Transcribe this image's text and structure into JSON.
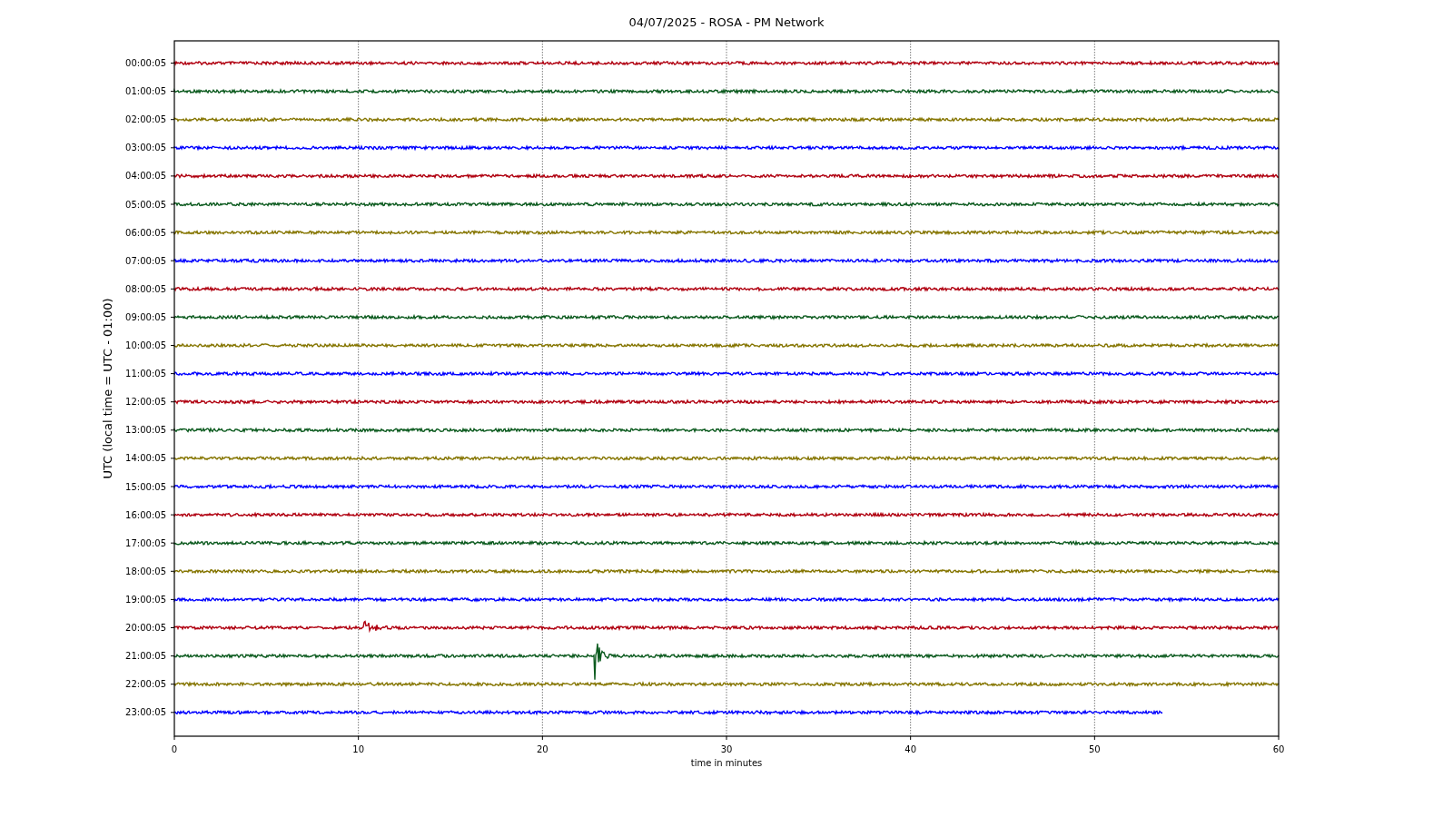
{
  "title": "04/07/2025 - ROSA - PM Network",
  "ylabel": "UTC (local time = UTC - 01:00)",
  "xlabel": "time in minutes",
  "xticks": [
    "0",
    "10",
    "20",
    "30",
    "40",
    "50",
    "60"
  ],
  "traces": [
    {
      "label": "00:00:05",
      "color": "#b00010",
      "level": 1
    },
    {
      "label": "01:00:05",
      "color": "#0b5a1e",
      "level": 1
    },
    {
      "label": "02:00:05",
      "color": "#857500",
      "level": 1
    },
    {
      "label": "03:00:05",
      "color": "#0000ff",
      "level": 1
    },
    {
      "label": "04:00:05",
      "color": "#b00010",
      "level": 1
    },
    {
      "label": "05:00:05",
      "color": "#0b5a1e",
      "level": 1
    },
    {
      "label": "06:00:05",
      "color": "#857500",
      "level": 1
    },
    {
      "label": "07:00:05",
      "color": "#0000ff",
      "level": 1
    },
    {
      "label": "08:00:05",
      "color": "#b00010",
      "level": 1
    },
    {
      "label": "09:00:05",
      "color": "#0b5a1e",
      "level": 1
    },
    {
      "label": "10:00:05",
      "color": "#857500",
      "level": 1
    },
    {
      "label": "11:00:05",
      "color": "#0000ff",
      "level": 1
    },
    {
      "label": "12:00:05",
      "color": "#b00010",
      "level": 1
    },
    {
      "label": "13:00:05",
      "color": "#0b5a1e",
      "level": 1
    },
    {
      "label": "14:00:05",
      "color": "#857500",
      "level": 1
    },
    {
      "label": "15:00:05",
      "color": "#0000ff",
      "level": 1
    },
    {
      "label": "16:00:05",
      "color": "#b00010",
      "level": 1
    },
    {
      "label": "17:00:05",
      "color": "#0b5a1e",
      "level": 1
    },
    {
      "label": "18:00:05",
      "color": "#857500",
      "level": 1
    },
    {
      "label": "19:00:05",
      "color": "#0000ff",
      "level": 1
    },
    {
      "label": "20:00:05",
      "color": "#b00010",
      "level": 1
    },
    {
      "label": "21:00:05",
      "color": "#0b5a1e",
      "level": 1
    },
    {
      "label": "22:00:05",
      "color": "#857500",
      "level": 1
    },
    {
      "label": "23:00:05",
      "color": "#0000ff",
      "level": 0.895
    }
  ]
}
